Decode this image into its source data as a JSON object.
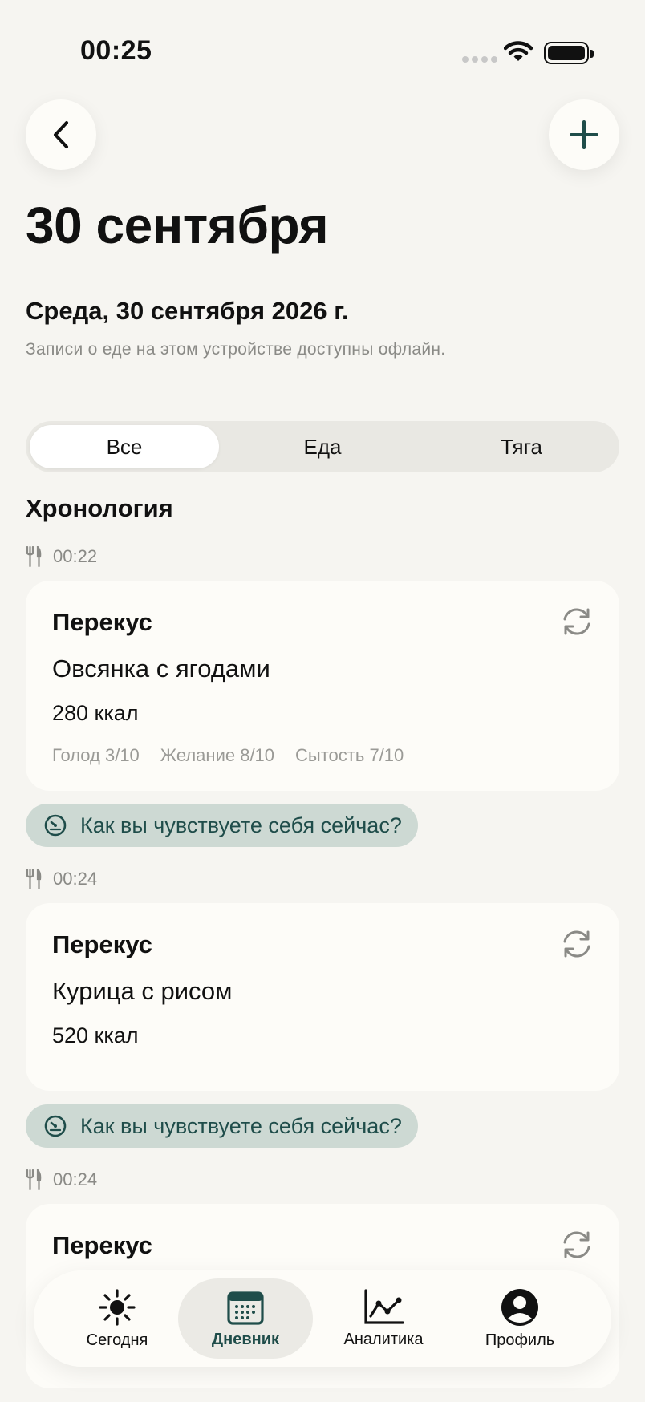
{
  "status": {
    "time": "00:25"
  },
  "header": {
    "title": "30 сентября",
    "date_line": "Среда, 30 сентября 2026 г.",
    "offline_note": "Записи о еде на этом устройстве доступны офлайн."
  },
  "filters": {
    "all": "Все",
    "food": "Еда",
    "craving": "Тяга",
    "selected": "Все"
  },
  "timeline": {
    "title": "Хронология",
    "entries": [
      {
        "time": "00:22",
        "meal": "Перекус",
        "dish": "Овсянка с ягодами",
        "kcal": "280 ккал",
        "hunger": "Голод 3/10",
        "desire": "Желание 8/10",
        "fullness": "Сытость 7/10"
      },
      {
        "time": "00:24",
        "meal": "Перекус",
        "dish": "Курица с рисом",
        "kcal": "520 ккал"
      },
      {
        "time": "00:24",
        "meal": "Перекус"
      }
    ],
    "feel_prompt": "Как вы чувствуете себя сейчас?"
  },
  "tabbar": {
    "today": "Сегодня",
    "diary": "Дневник",
    "analytics": "Аналитика",
    "profile": "Профиль",
    "active": "Дневник"
  },
  "colors": {
    "accent": "#1f4d4a",
    "background": "#f6f5f1",
    "card": "#fdfcf8",
    "pill": "#cdd9d3"
  }
}
